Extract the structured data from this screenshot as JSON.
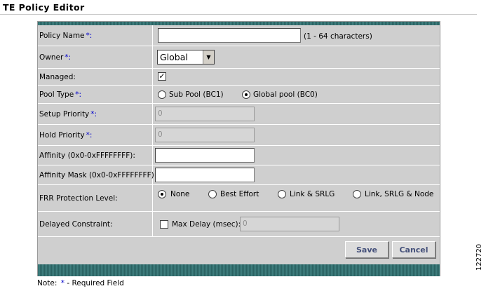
{
  "page_title": "TE Policy Editor",
  "fields": {
    "policy_name": {
      "label": "Policy Name",
      "required": "*:",
      "value": "",
      "hint": "(1 - 64 characters)"
    },
    "owner": {
      "label": "Owner",
      "required": "*:",
      "selected": "Global"
    },
    "managed": {
      "label": "Managed:",
      "checked": true,
      "check_glyph": "✓"
    },
    "pool_type": {
      "label": "Pool Type",
      "required": "*:",
      "options": [
        "Sub Pool (BC1)",
        "Global pool (BC0)"
      ],
      "selected": "Global pool (BC0)"
    },
    "setup_priority": {
      "label": "Setup Priority",
      "required": "*:",
      "value": "0"
    },
    "hold_priority": {
      "label": "Hold Priority",
      "required": "*:",
      "value": "0"
    },
    "affinity": {
      "label": "Affinity (0x0-0xFFFFFFFF):",
      "value": ""
    },
    "affinity_mask": {
      "label": "Affinity Mask (0x0-0xFFFFFFFF):",
      "value": ""
    },
    "frr": {
      "label": "FRR Protection Level:",
      "options": [
        "None",
        "Best Effort",
        "Link & SRLG",
        "Link, SRLG & Node"
      ],
      "selected": "None"
    },
    "delayed_constraint": {
      "label": "Delayed Constraint:",
      "checkbox_label": "Max Delay (msec):",
      "checked": false,
      "value": "0"
    }
  },
  "buttons": {
    "save": "Save",
    "cancel": "Cancel"
  },
  "note": {
    "prefix": "Note:",
    "star": "*",
    "text": "- Required Field"
  },
  "side_number": "122720",
  "colors": {
    "panel": "#cfcfcf",
    "stripe": "#2e6a6a",
    "required_star": "#0000cc"
  }
}
